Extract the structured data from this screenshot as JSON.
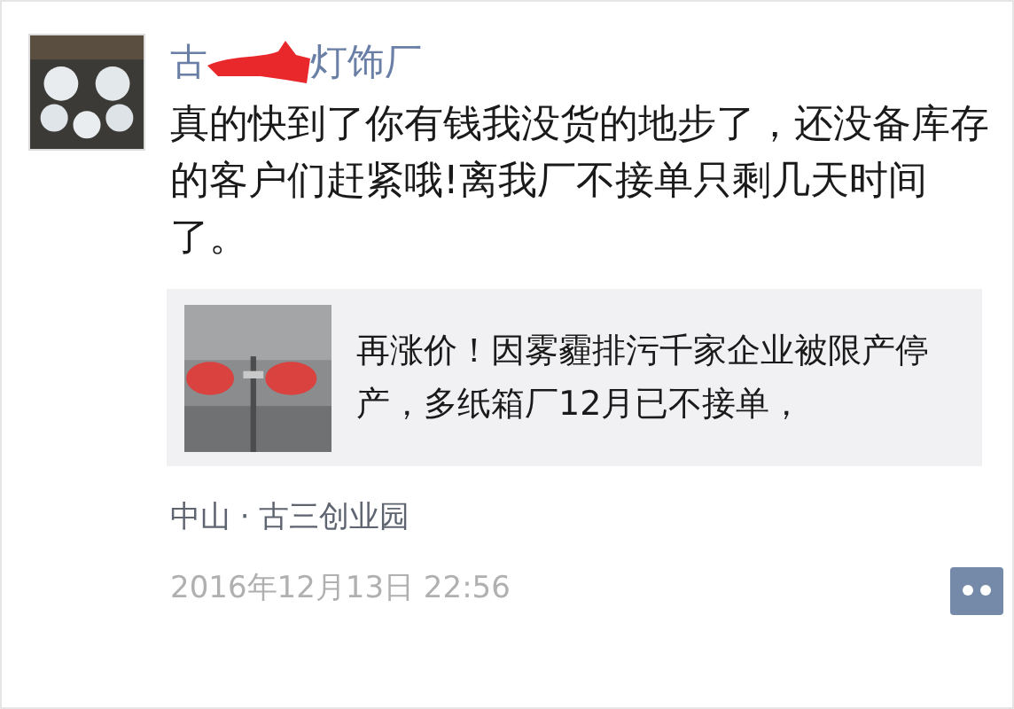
{
  "post": {
    "author": {
      "name_start": "古",
      "name_end": "灯饰厂",
      "redacted": true
    },
    "text": "真的快到了你有钱我没货的地步了，还没备库存的客户们赶紧哦!离我厂不接单只剩几天时间了。",
    "link_card": {
      "title": "再涨价！因雾霾排污千家企业被限产停产，多纸箱厂12月已不接单，"
    },
    "location": "中山 · 古三创业园",
    "time": "2016年12月13日 22:56"
  }
}
